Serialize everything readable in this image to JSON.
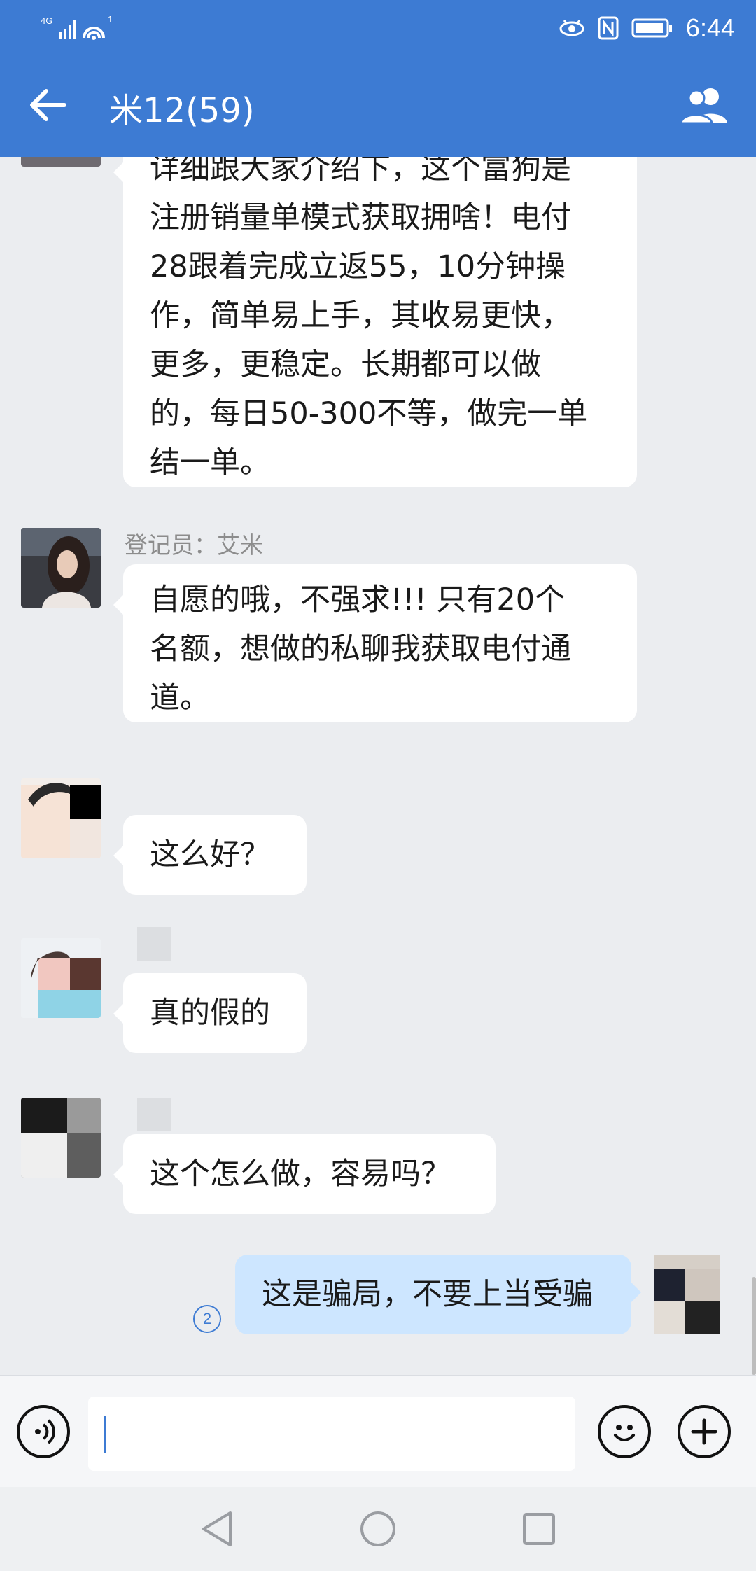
{
  "status_bar": {
    "network": "4G",
    "hotspot_count": "1",
    "time": "6:44"
  },
  "header": {
    "title": "米12(59)",
    "back_icon": "arrow-left-icon",
    "members_icon": "group-members-icon"
  },
  "messages": [
    {
      "direction": "in",
      "sender": "",
      "text": "详细跟大家介绍下，这个富狗是\n注册销量单模式获取拥啥！电付\n28跟着完成立返55，10分钟操\n作，简单易上手，其收易更快，\n更多，更稳定。长期都可以做\n的，每日50-300不等，做完一单\n结一单。"
    },
    {
      "direction": "in",
      "sender": "登记员：艾米",
      "text": "自愿的哦，不强求!!! 只有20个\n名额，想做的私聊我获取电付通\n道。"
    },
    {
      "direction": "in",
      "sender": "",
      "text": "这么好？"
    },
    {
      "direction": "in",
      "sender": "",
      "text": "真的假的"
    },
    {
      "direction": "in",
      "sender": "",
      "text": "这个怎么做，容易吗？"
    },
    {
      "direction": "out",
      "read_count": "2",
      "text": "这是骗局，不要上当受骗"
    }
  ],
  "input_bar": {
    "voice_icon": "voice-input-icon",
    "emoji_icon": "emoji-icon",
    "plus_icon": "plus-icon",
    "value": "",
    "placeholder": ""
  },
  "nav_bar": {
    "back_icon": "nav-back-icon",
    "home_icon": "nav-home-icon",
    "recents_icon": "nav-recents-icon"
  },
  "colors": {
    "accent": "#3D7BD3",
    "incoming_bubble": "#FFFFFF",
    "outgoing_bubble": "#CDE6FF",
    "background": "#EBEDF0"
  }
}
